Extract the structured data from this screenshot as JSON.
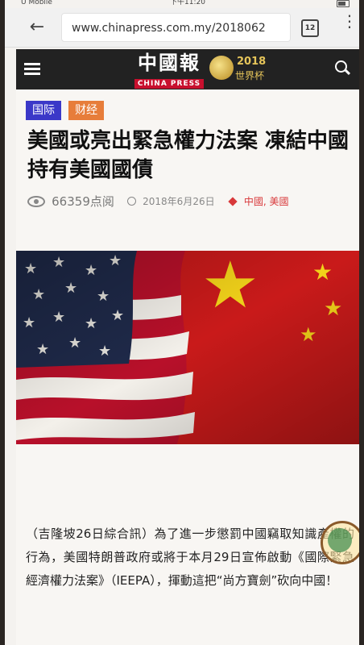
{
  "status": {
    "carrier": "U Mobile",
    "time": "下午11:20"
  },
  "browser": {
    "url": "www.chinapress.com.my/2018062",
    "tab_count": "12"
  },
  "site": {
    "logo_cn": "中國報",
    "logo_en": "CHINA PRESS",
    "cup_year": "2018",
    "cup_label": "世界杯"
  },
  "article": {
    "tags": [
      "国际",
      "财经"
    ],
    "title": "美國或亮出緊急權力法案 凍結中國持有美國國債",
    "views": "66359点阅",
    "date": "2018年6月26日",
    "categories": "中國, 美國",
    "body": "（吉隆坡26日綜合訊）為了進一步懲罰中國竊取知識產權的行為，美國特朗普政府或將于本月29日宣佈啟動《國際緊急經濟權力法案》（IEEPA），揮動這把“尚方寶劍”砍向中國！"
  },
  "colors": {
    "tag_blue": "#3b38c8",
    "tag_orange": "#e77d3a",
    "category_red": "#d8383a",
    "sitebar": "#222222"
  }
}
